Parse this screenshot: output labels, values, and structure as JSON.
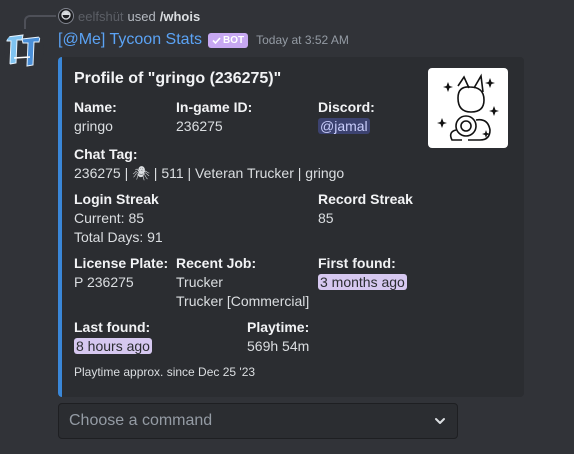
{
  "reply": {
    "username": "eelfshüt",
    "used_text": "used",
    "command": "/whois"
  },
  "message": {
    "author": "[@Me] Tycoon Stats",
    "bot_tag": "BOT",
    "timestamp": "Today at 3:52 AM"
  },
  "embed": {
    "accent_color": "#3a87d8",
    "title": "Profile of \"gringo (236275)\"",
    "fields": {
      "name": {
        "name": "Name:",
        "value": "gringo"
      },
      "ingame_id": {
        "name": "In-game ID:",
        "value": "236275"
      },
      "discord": {
        "name": "Discord:",
        "value": "@jamal"
      },
      "chat_tag": {
        "name": "Chat Tag:",
        "value": "236275 | 🕷 | 511 | Veteran Trucker | gringo"
      },
      "login_streak": {
        "name": "Login Streak",
        "current": "Current: 85",
        "total": "Total Days: 91"
      },
      "record_streak": {
        "name": "Record Streak",
        "value": "85"
      },
      "license_plate": {
        "name": "License Plate:",
        "value": "P 236275"
      },
      "recent_job": {
        "name": "Recent Job:",
        "line1": "Trucker",
        "line2": "Trucker [Commercial]"
      },
      "first_found": {
        "name": "First found:",
        "value": "3 months ago"
      },
      "last_found": {
        "name": "Last found:",
        "value": "8 hours ago"
      },
      "playtime": {
        "name": "Playtime:",
        "value": "569h 54m"
      }
    },
    "footer": "Playtime approx. since Dec 25 '23"
  },
  "select_menu": {
    "placeholder": "Choose a command",
    "icon": "chevron-down-icon"
  }
}
